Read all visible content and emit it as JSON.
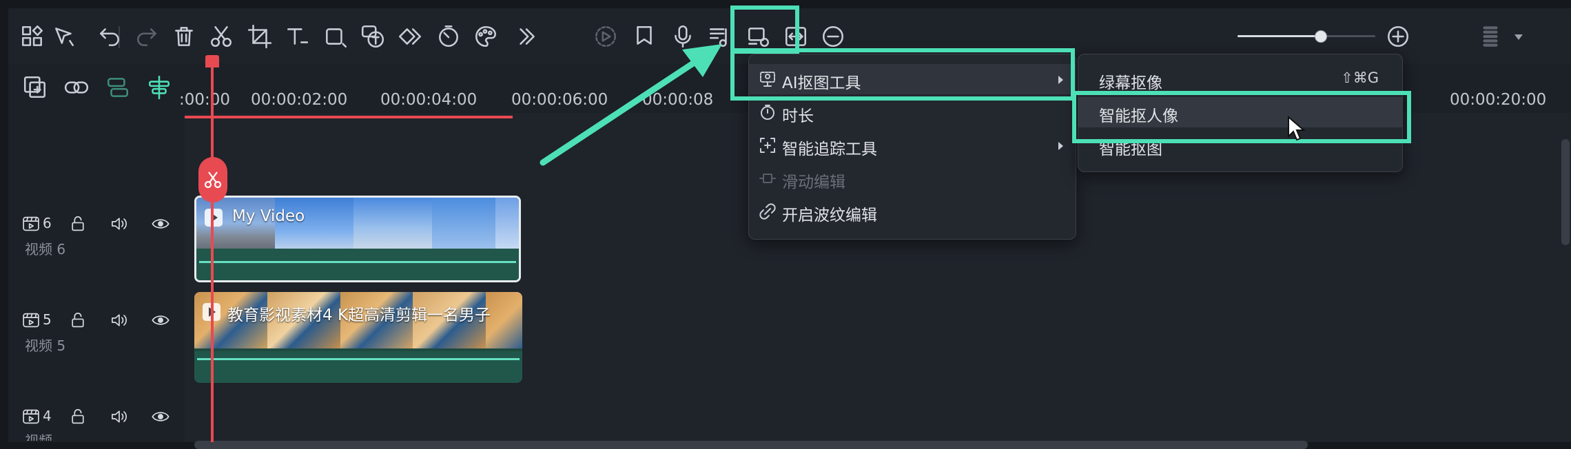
{
  "toolbar": {
    "icons": [
      "layout-icon",
      "select-tool-icon",
      "undo-icon",
      "redo-icon",
      "delete-icon",
      "split-icon",
      "crop-icon",
      "text-icon",
      "shape-icon",
      "speech-to-text-icon",
      "keyframe-icon",
      "speed-icon",
      "color-icon",
      "more-tools-icon",
      "render-preview-icon",
      "marker-icon",
      "microphone-icon",
      "audio-icon",
      "snapshot-icon",
      "fit-icon",
      "zoom-out-icon",
      "zoom-in-icon",
      "panel-layout-icon"
    ],
    "zoom_level_fraction": 0.6
  },
  "ruler": {
    "timecodes": [
      ":00:00",
      "00:00:02:00",
      "00:00:04:00",
      "00:00:06:00",
      "00:00:08",
      "00:00:20:00"
    ]
  },
  "tracks": [
    {
      "number": "6",
      "name": "视频 6"
    },
    {
      "number": "5",
      "name": "视频 5"
    },
    {
      "number": "4",
      "name": "视频"
    }
  ],
  "clips": [
    {
      "title": "My Video"
    },
    {
      "title": "教育影视素材4 K超高清剪辑一名男子"
    }
  ],
  "context_menu": {
    "items": [
      {
        "label": "AI抠图工具",
        "icon": "ai-cutout-icon",
        "has_submenu": true,
        "disabled": false
      },
      {
        "label": "时长",
        "icon": "timer-icon",
        "has_submenu": false,
        "disabled": false
      },
      {
        "label": "智能追踪工具",
        "icon": "tracking-icon",
        "has_submenu": true,
        "disabled": false
      },
      {
        "label": "滑动编辑",
        "icon": "slide-edit-icon",
        "has_submenu": false,
        "disabled": true
      },
      {
        "label": "开启波纹编辑",
        "icon": "ripple-icon",
        "has_submenu": false,
        "disabled": false
      }
    ]
  },
  "submenu": {
    "items": [
      {
        "label": "绿幕抠像",
        "shortcut": "⇧⌘G"
      },
      {
        "label": "智能抠人像",
        "shortcut": ""
      },
      {
        "label": "智能抠图",
        "shortcut": ""
      }
    ]
  },
  "colors": {
    "highlight": "#4de0b7",
    "playhead": "#e84a52",
    "clip": "#1e4a40",
    "background": "#1c2027"
  }
}
